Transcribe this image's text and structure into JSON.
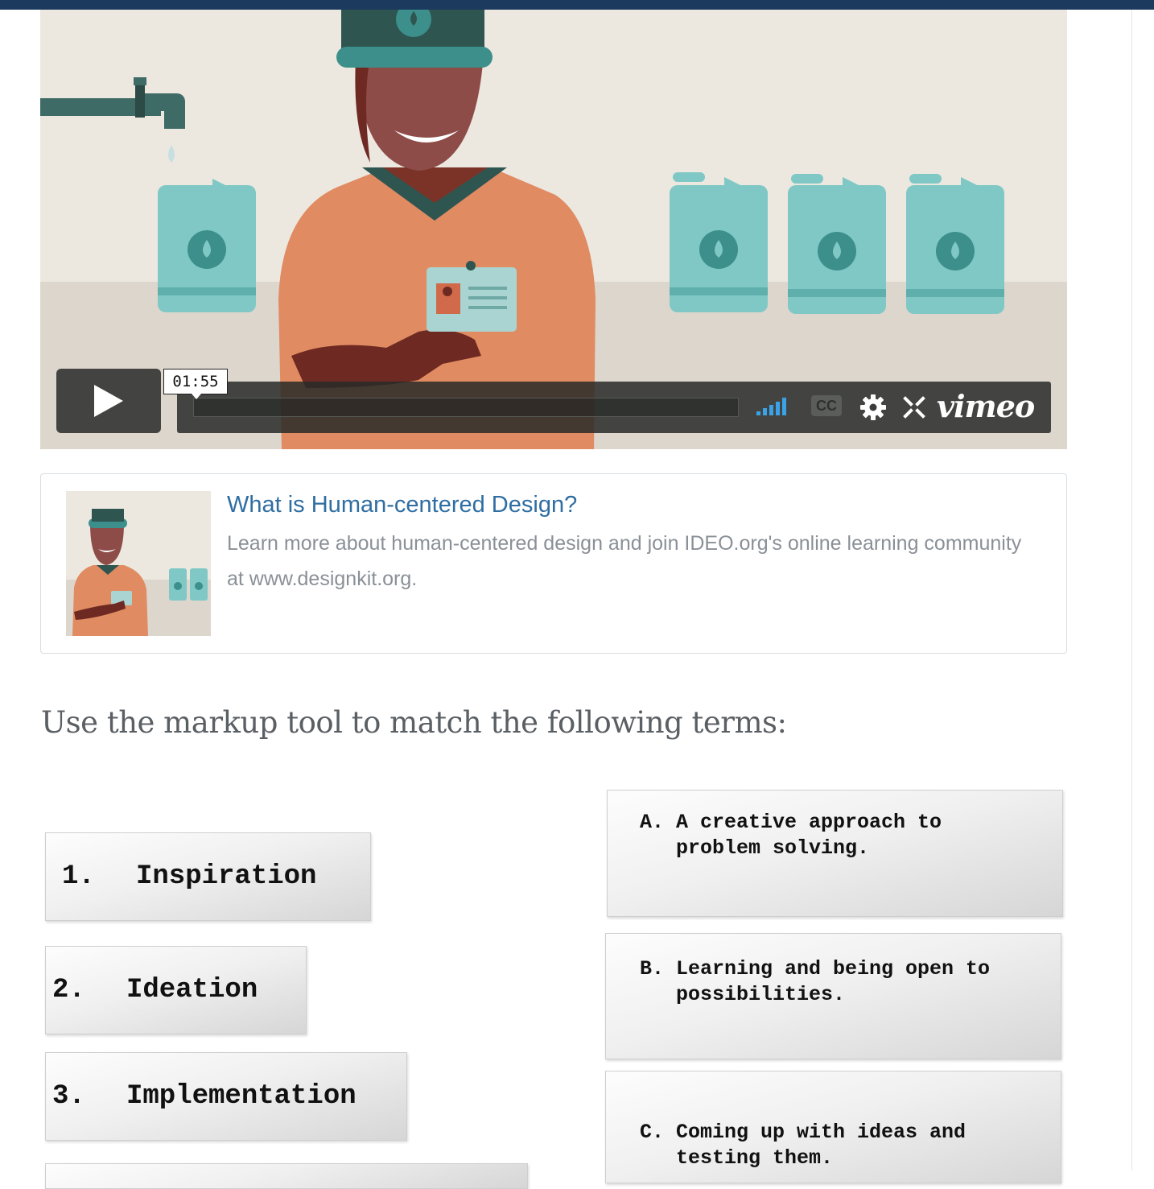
{
  "video": {
    "timestamp": "01:55",
    "cc_label": "CC",
    "brand": "vimeo",
    "play_icon": "play-icon",
    "volume_icon": "volume-bars-icon",
    "settings_icon": "gear-icon",
    "fullscreen_icon": "fullscreen-icon"
  },
  "card": {
    "title": "What is Human-centered Design?",
    "description": "Learn more about human-centered design and join IDEO.org's online learning community at www.designkit.org."
  },
  "exercise": {
    "heading": "Use the markup tool to match the following terms:",
    "terms": [
      {
        "num": "1.",
        "label": "Inspiration"
      },
      {
        "num": "2.",
        "label": "Ideation"
      },
      {
        "num": "3.",
        "label": "Implementation"
      }
    ],
    "definitions": [
      {
        "letter": "A.",
        "line1": "A creative approach to",
        "line2": "problem solving."
      },
      {
        "letter": "B.",
        "line1": "Learning and being open to",
        "line2": "possibilities."
      },
      {
        "letter": "C.",
        "line1": "Coming up with ideas and",
        "line2": "testing them."
      }
    ]
  },
  "colors": {
    "top_bar": "#1c3a5e",
    "link_title": "#2f6ea2",
    "volume_accent": "#3aa2e6"
  }
}
